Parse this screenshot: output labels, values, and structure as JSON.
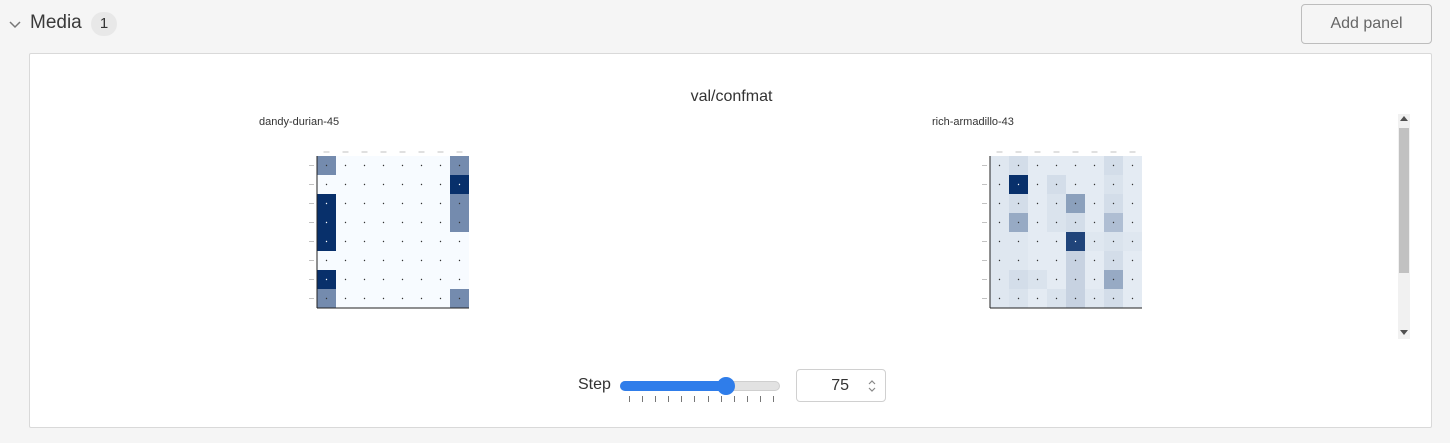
{
  "section": {
    "title": "Media",
    "count": "1",
    "add_panel_label": "Add panel"
  },
  "panel": {
    "title": "val/confmat",
    "runs": [
      {
        "name": "dandy-durian-45",
        "matrix": [
          [
            0.55,
            0,
            0,
            0,
            0,
            0,
            0,
            0.55
          ],
          [
            0,
            0,
            0,
            0,
            0,
            0,
            0,
            1.0
          ],
          [
            1.0,
            0,
            0,
            0,
            0,
            0,
            0,
            0.55
          ],
          [
            1.0,
            0,
            0,
            0,
            0,
            0,
            0,
            0.55
          ],
          [
            1.0,
            0,
            0,
            0,
            0,
            0,
            0,
            0
          ],
          [
            0,
            0,
            0,
            0,
            0,
            0,
            0,
            0
          ],
          [
            1.0,
            0,
            0,
            0,
            0,
            0,
            0,
            0
          ],
          [
            0.55,
            0,
            0,
            0,
            0,
            0,
            0,
            0.55
          ]
        ]
      },
      {
        "name": "rich-armadillo-43",
        "matrix": [
          [
            0.1,
            0.15,
            0.08,
            0.08,
            0.08,
            0.08,
            0.15,
            0.08
          ],
          [
            0.1,
            1.0,
            0.08,
            0.15,
            0.08,
            0.08,
            0.12,
            0.08
          ],
          [
            0.1,
            0.15,
            0.08,
            0.12,
            0.45,
            0.08,
            0.15,
            0.08
          ],
          [
            0.1,
            0.4,
            0.08,
            0.12,
            0.15,
            0.08,
            0.3,
            0.08
          ],
          [
            0.1,
            0.1,
            0.08,
            0.08,
            0.9,
            0.1,
            0.12,
            0.1
          ],
          [
            0.1,
            0.1,
            0.08,
            0.08,
            0.2,
            0.08,
            0.15,
            0.08
          ],
          [
            0.1,
            0.15,
            0.12,
            0.08,
            0.2,
            0.08,
            0.4,
            0.08
          ],
          [
            0.1,
            0.12,
            0.08,
            0.12,
            0.2,
            0.1,
            0.15,
            0.08
          ]
        ]
      }
    ],
    "scrollbar_position": 0.0
  },
  "step": {
    "label": "Step",
    "value": "75",
    "slider_fraction": 0.66,
    "tick_count": 12
  },
  "colors": {
    "accent": "#2f7dea",
    "cm_low": "#f7fbff",
    "cm_high": "#08306b"
  },
  "icons": {
    "collapse": "chevron-down-icon",
    "spinner": "spinner-arrows-icon"
  }
}
